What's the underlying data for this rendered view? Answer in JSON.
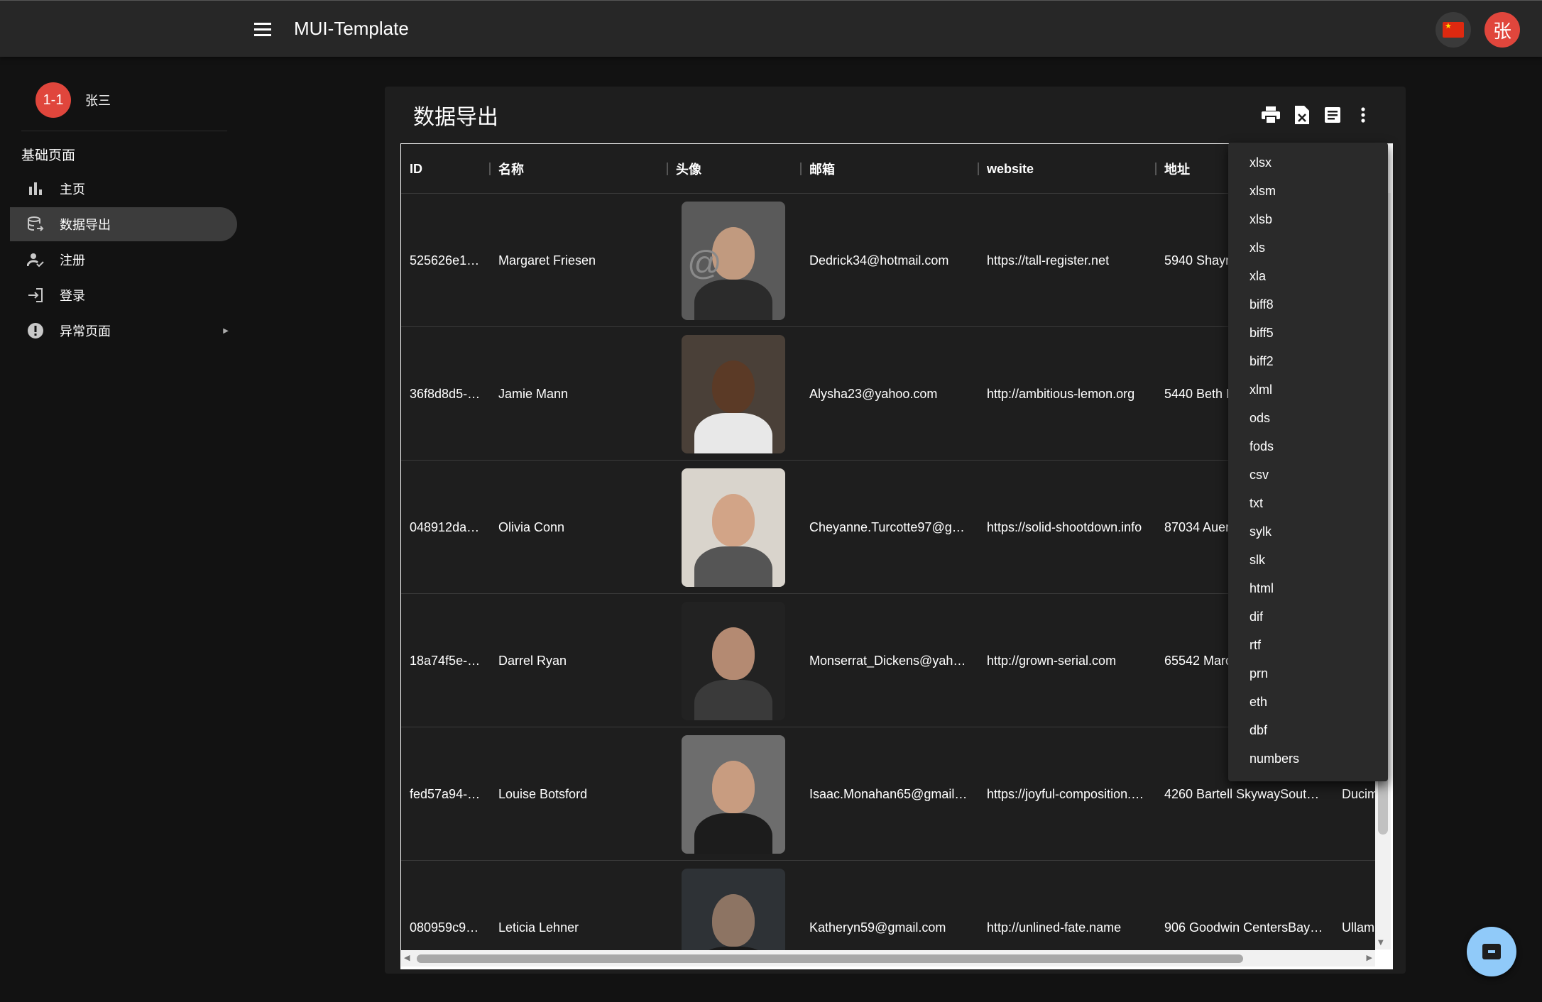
{
  "appbar": {
    "title": "MUI-Template",
    "avatar_text": "张",
    "language_icon": "china-flag-icon"
  },
  "sidebar": {
    "user": {
      "avatar_text": "1-1",
      "name": "张三"
    },
    "section_title": "基础页面",
    "items": [
      {
        "label": "主页",
        "icon": "bar-chart-icon"
      },
      {
        "label": "数据导出",
        "icon": "database-export-icon",
        "active": true
      },
      {
        "label": "注册",
        "icon": "person-check-icon"
      },
      {
        "label": "登录",
        "icon": "login-icon"
      },
      {
        "label": "异常页面",
        "icon": "error-icon",
        "expandable": true
      }
    ]
  },
  "main": {
    "title": "数据导出",
    "toolbar_icons": [
      "print-icon",
      "excel-icon",
      "document-icon",
      "more-vert-icon"
    ]
  },
  "table": {
    "columns": [
      "ID",
      "名称",
      "头像",
      "邮箱",
      "website",
      "地址"
    ],
    "rows": [
      {
        "id": "525626e1…",
        "name": "Margaret Friesen",
        "email": "Dedrick34@hotmail.com",
        "website": "https://tall-register.net",
        "address": "5940 Shayn",
        "extra": ""
      },
      {
        "id": "36f8d8d5-…",
        "name": "Jamie Mann",
        "email": "Alysha23@yahoo.com",
        "website": "http://ambitious-lemon.org",
        "address": "5440 Beth F",
        "extra": ""
      },
      {
        "id": "048912da…",
        "name": "Olivia Conn",
        "email": "Cheyanne.Turcotte97@g…",
        "website": "https://solid-shootdown.info",
        "address": "87034 Auer",
        "extra": ""
      },
      {
        "id": "18a74f5e-…",
        "name": "Darrel Ryan",
        "email": "Monserrat_Dickens@yah…",
        "website": "http://grown-serial.com",
        "address": "65542 Marc",
        "extra": ""
      },
      {
        "id": "fed57a94-…",
        "name": "Louise Botsford",
        "email": "Isaac.Monahan65@gmail…",
        "website": "https://joyful-composition.…",
        "address": "4260 Bartell SkywaySout…",
        "extra": "Ducim"
      },
      {
        "id": "080959c9…",
        "name": "Leticia Lehner",
        "email": "Katheryn59@gmail.com",
        "website": "http://unlined-fate.name",
        "address": "906 Goodwin CentersBay…",
        "extra": "Ullam"
      }
    ]
  },
  "export_menu": {
    "options": [
      "xlsx",
      "xlsm",
      "xlsb",
      "xls",
      "xla",
      "biff8",
      "biff5",
      "biff2",
      "xlml",
      "ods",
      "fods",
      "csv",
      "txt",
      "sylk",
      "slk",
      "html",
      "dif",
      "rtf",
      "prn",
      "eth",
      "dbf",
      "numbers"
    ]
  },
  "fab": {
    "icon": "archive-icon"
  },
  "colors": {
    "appbar_bg": "#272727",
    "page_bg": "#121212",
    "card_bg": "#1e1e1e",
    "avatar_red": "#e0463c",
    "fab_blue": "#90caf9"
  }
}
